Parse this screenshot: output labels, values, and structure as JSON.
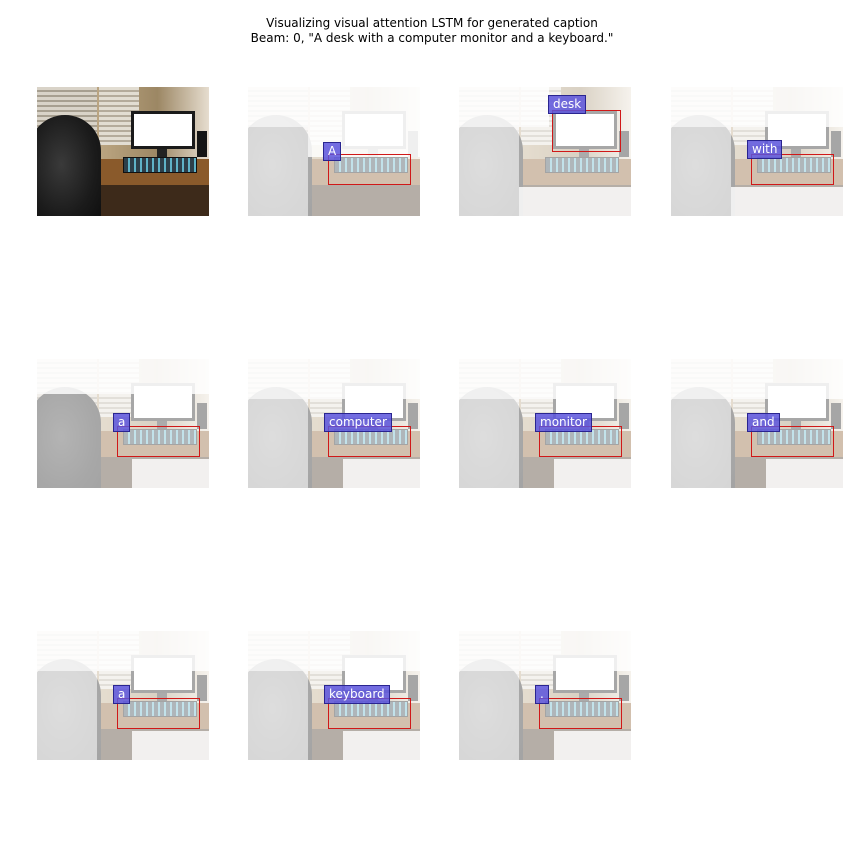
{
  "figure": {
    "title_line1": "Visualizing visual attention LSTM for generated caption",
    "title_line2": "Beam: 0, \"A desk with a computer monitor and a keyboard.\""
  },
  "panels": [
    {
      "word": "",
      "original": true
    },
    {
      "word": "A"
    },
    {
      "word": "desk"
    },
    {
      "word": "with"
    },
    {
      "word": "a"
    },
    {
      "word": "computer"
    },
    {
      "word": "monitor"
    },
    {
      "word": "and"
    },
    {
      "word": "a"
    },
    {
      "word": "keyboard"
    },
    {
      "word": "."
    }
  ],
  "colors": {
    "box_border": "#d01818",
    "label_bg": "#5a54dc",
    "label_text": "#ffffff"
  }
}
